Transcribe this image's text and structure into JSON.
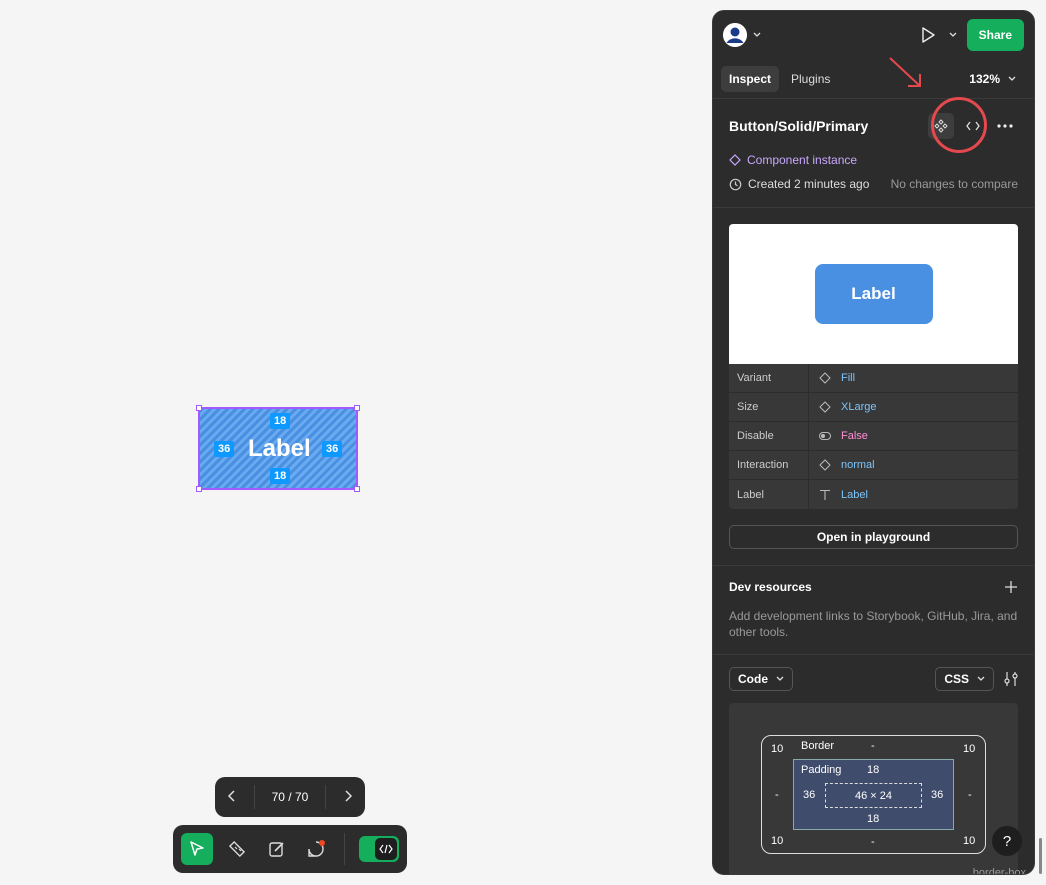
{
  "canvas": {
    "selection_label": "Label",
    "padding_top": "18",
    "padding_bottom": "18",
    "padding_left": "36",
    "padding_right": "36"
  },
  "pager": {
    "text": "70 / 70"
  },
  "toolbar": {
    "tools": [
      "move-icon",
      "ruler-icon",
      "annotate-icon",
      "comment-icon"
    ]
  },
  "panel": {
    "share_label": "Share",
    "tabs": [
      "Inspect",
      "Plugins"
    ],
    "zoom": "132%",
    "component_name": "Button/Solid/Primary",
    "instance_label": "Component instance",
    "created": "Created 2 minutes ago",
    "no_changes": "No changes to compare",
    "preview_label": "Label",
    "properties": [
      {
        "key": "Variant",
        "value": "Fill",
        "icon": "diamond-icon",
        "color": "blue"
      },
      {
        "key": "Size",
        "value": "XLarge",
        "icon": "diamond-icon",
        "color": "blue"
      },
      {
        "key": "Disable",
        "value": "False",
        "icon": "toggle-icon",
        "color": "pink"
      },
      {
        "key": "Interaction",
        "value": "normal",
        "icon": "diamond-icon",
        "color": "blue"
      },
      {
        "key": "Label",
        "value": "Label",
        "icon": "text-icon",
        "color": "blue"
      }
    ],
    "open_playground": "Open in playground",
    "dev_resources_title": "Dev resources",
    "dev_resources_desc": "Add development links to Storybook, GitHub, Jira, and other tools.",
    "code_select": "Code",
    "lang_select": "CSS",
    "box_model": {
      "border_label": "Border",
      "border_value": "-",
      "padding_label": "Padding",
      "padding_top": "18",
      "padding_bottom": "18",
      "padding_left": "36",
      "padding_right": "36",
      "content": "46 × 24",
      "radius": "10",
      "side_dash": "-",
      "box_sizing": "border-box"
    },
    "help": "?"
  },
  "colors": {
    "accent_green": "#14ae5c",
    "selection_purple": "#a259ff",
    "button_blue": "#4a90e2",
    "annotation_red": "#e5484d"
  }
}
